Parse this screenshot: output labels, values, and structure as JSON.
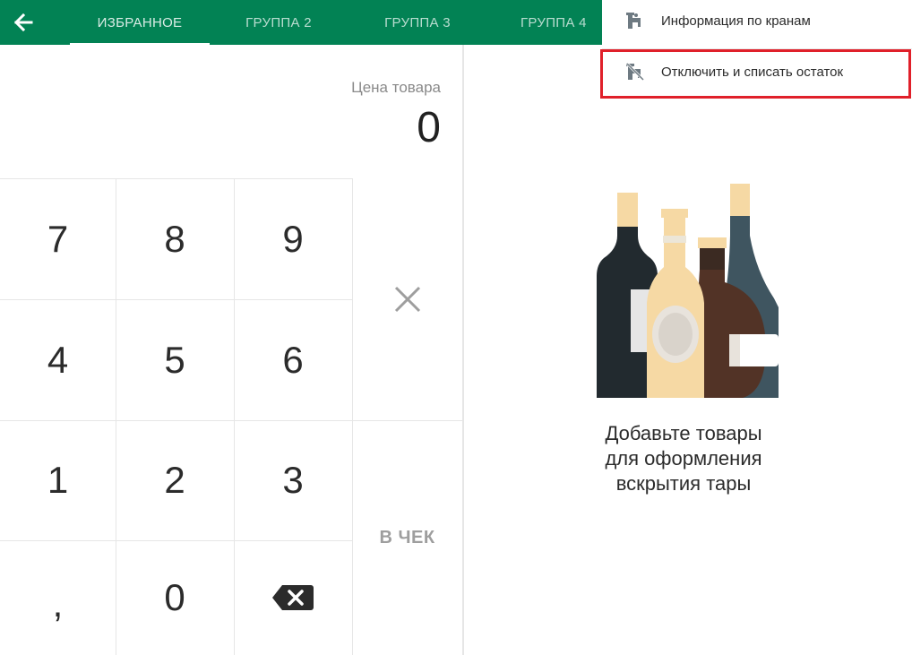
{
  "topbar": {
    "bg_color": "#028254",
    "back_icon": "arrow-left-icon",
    "tabs": [
      {
        "label": "ИЗБРАННОЕ",
        "active": true
      },
      {
        "label": "ГРУППА 2",
        "active": false
      },
      {
        "label": "ГРУППА 3",
        "active": false
      },
      {
        "label": "ГРУППА 4",
        "active": false
      }
    ]
  },
  "price": {
    "label": "Цена товара",
    "value": "0"
  },
  "keypad": {
    "keys": [
      "7",
      "8",
      "9",
      "4",
      "5",
      "6",
      "1",
      "2",
      "3",
      ",",
      "0"
    ],
    "clear_icon": "close-icon",
    "backspace_icon": "backspace-icon",
    "check_label": "В ЧЕК"
  },
  "menu": {
    "items": [
      {
        "label": "Информация по кранам",
        "icon": "tap-info-icon"
      },
      {
        "label": "Отключить и списать остаток",
        "icon": "tap-off-icon",
        "highlighted": true
      }
    ],
    "highlight_color": "#e0202a"
  },
  "empty_state": {
    "lines": [
      "Добавьте товары",
      "для оформления",
      "вскрытия тары"
    ],
    "illustration": "bottles-illustration"
  }
}
